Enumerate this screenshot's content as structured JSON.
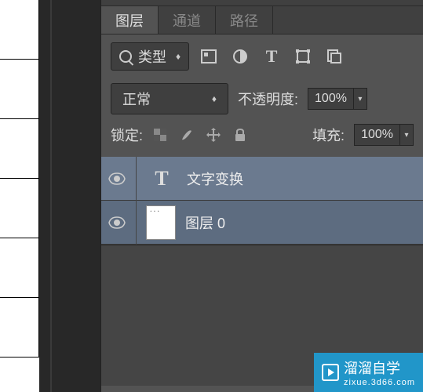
{
  "tabs": {
    "layers": "图层",
    "channels": "通道",
    "paths": "路径"
  },
  "filter": {
    "kind": "类型"
  },
  "blend": {
    "mode": "正常",
    "opacity_label": "不透明度:",
    "opacity_value": "100%"
  },
  "lock": {
    "label": "锁定:",
    "fill_label": "填充:",
    "fill_value": "100%"
  },
  "layers_list": [
    {
      "type": "text",
      "name": "文字变换"
    },
    {
      "type": "image",
      "name": "图层 0"
    }
  ],
  "watermark": {
    "title": "溜溜自学",
    "sub": "zixue.3d66.com"
  }
}
